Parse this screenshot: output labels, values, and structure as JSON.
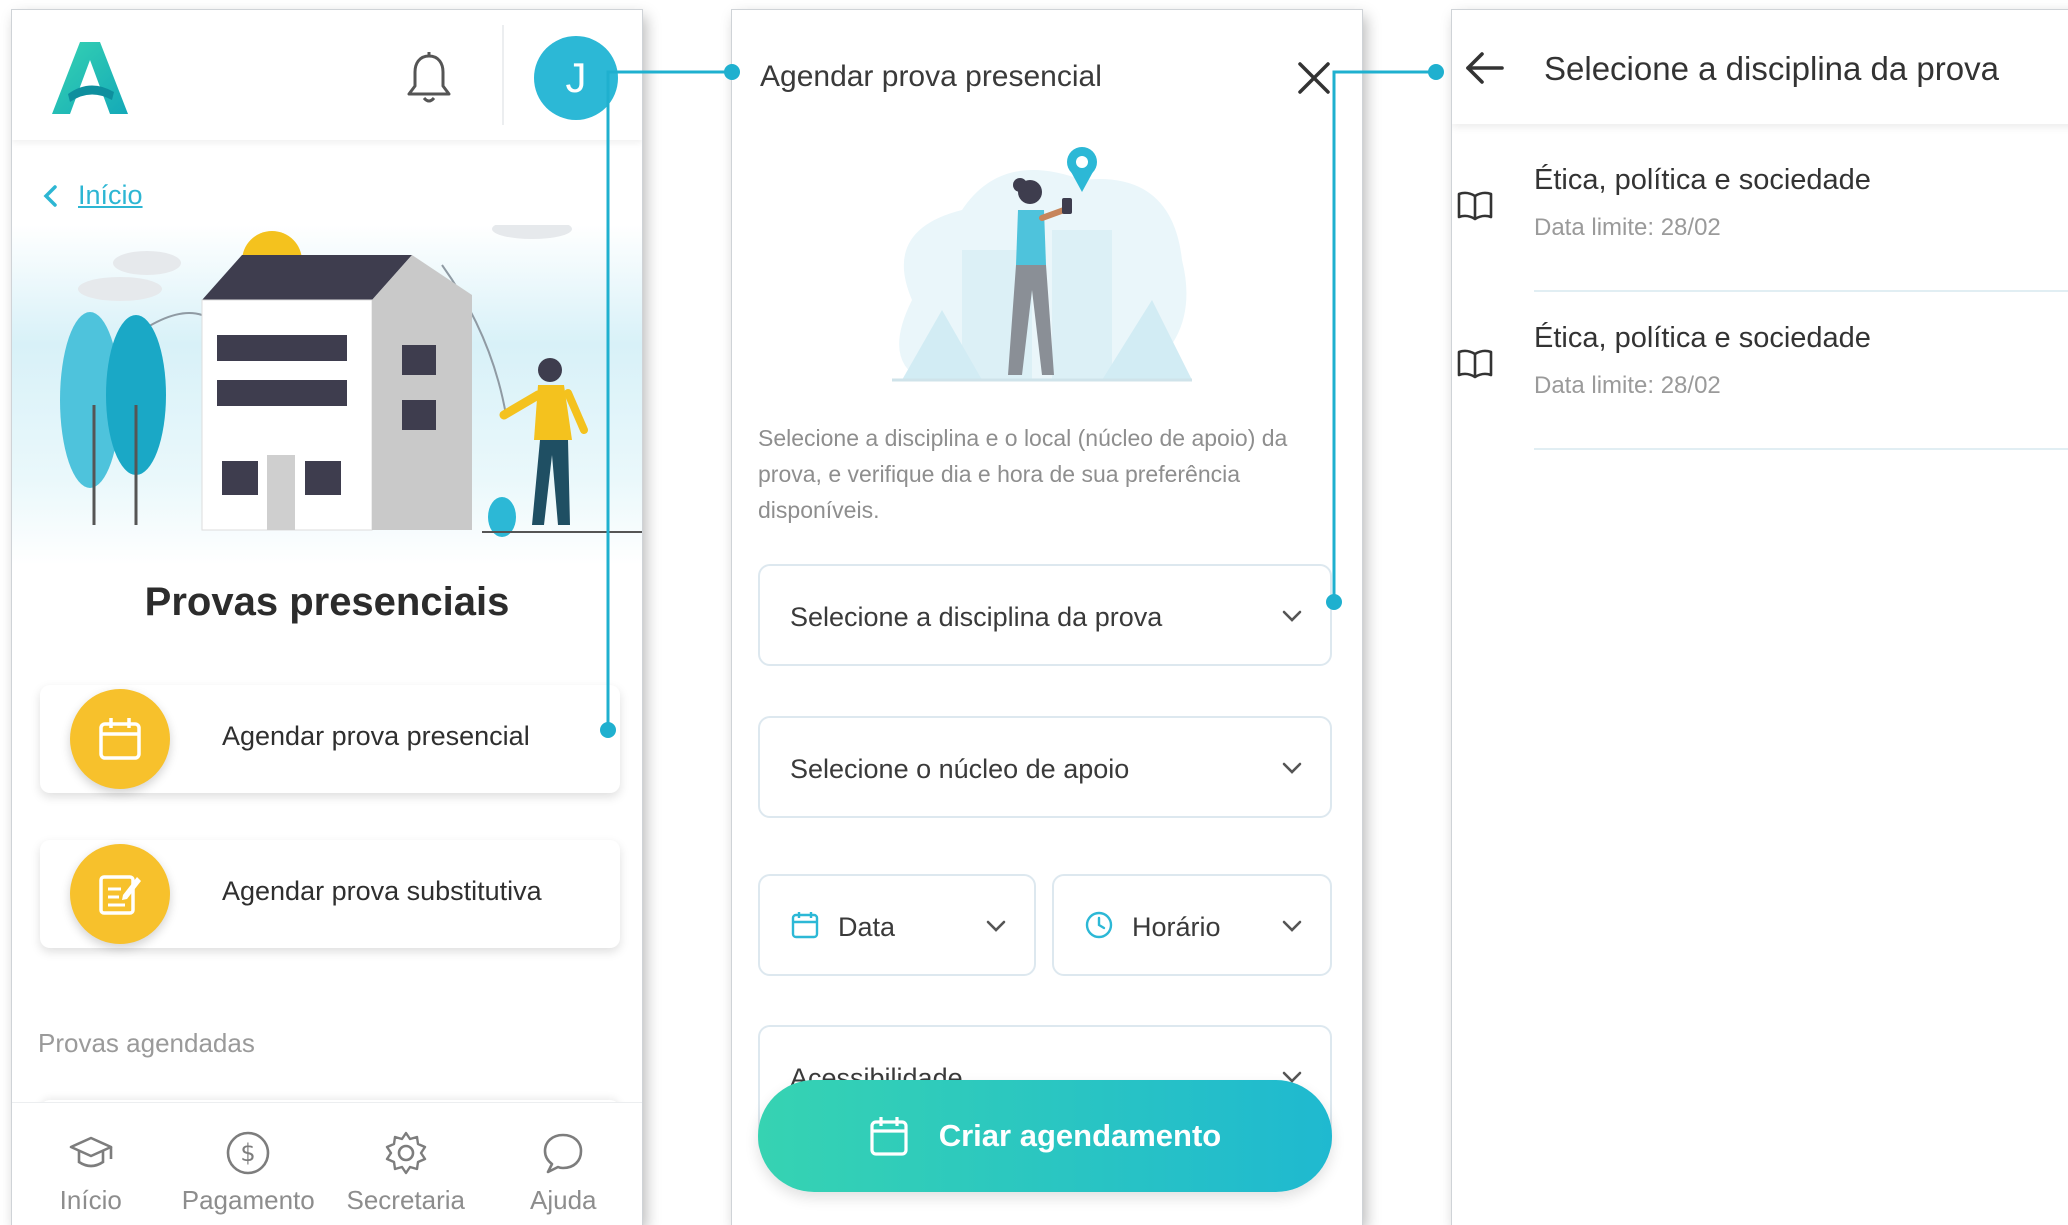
{
  "screen1": {
    "avatar_initial": "J",
    "breadcrumb": "Início",
    "title": "Provas presenciais",
    "actions": [
      {
        "label": "Agendar prova presencial",
        "icon": "calendar-icon"
      },
      {
        "label": "Agendar prova substitutiva",
        "icon": "edit-document-icon"
      }
    ],
    "section_label": "Provas agendadas",
    "nav": [
      {
        "label": "Início",
        "icon": "graduation-cap-icon"
      },
      {
        "label": "Pagamento",
        "icon": "dollar-coin-icon"
      },
      {
        "label": "Secretaria",
        "icon": "gear-icon"
      },
      {
        "label": "Ajuda",
        "icon": "chat-bubble-icon"
      }
    ]
  },
  "screen2": {
    "title": "Agendar prova presencial",
    "description": "Selecione a disciplina e o local (núcleo de apoio) da prova, e verifique dia e hora de sua preferência disponíveis.",
    "fields": {
      "disciplina": "Selecione a disciplina da prova",
      "nucleo": "Selecione o núcleo de apoio",
      "data": "Data",
      "horario": "Horário",
      "acessibilidade": "Acessibilidade"
    },
    "cta": "Criar agendamento"
  },
  "screen3": {
    "title": "Selecione a disciplina da prova",
    "subjects": [
      {
        "name": "Ética, política e sociedade",
        "due": "Data limite: 28/02"
      },
      {
        "name": "Ética, política e sociedade",
        "due": "Data limite: 28/02"
      }
    ]
  },
  "colors": {
    "accent": "#2cb8d6",
    "yellow": "#f7c12c",
    "cta_start": "#36d3b2",
    "cta_end": "#1fb9d0",
    "connector": "#1fb0cf"
  }
}
